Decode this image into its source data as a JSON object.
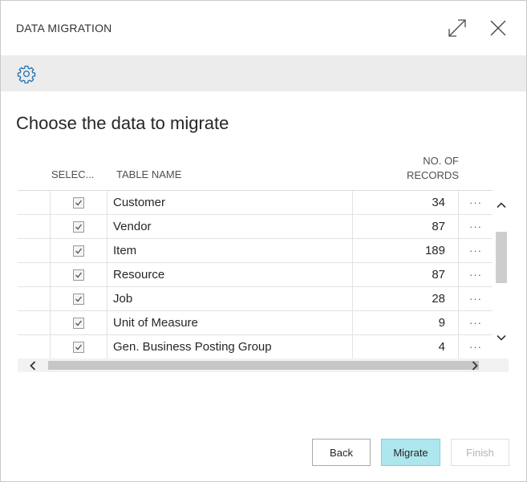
{
  "dialog": {
    "title": "DATA MIGRATION",
    "expand_icon": "expand-icon",
    "close_icon": "close-icon"
  },
  "actionbar": {
    "settings_icon": "gear-icon"
  },
  "page": {
    "heading": "Choose the data to migrate"
  },
  "table": {
    "columns": {
      "select": "SELEC...",
      "table_name": "TABLE NAME",
      "records_line1": "NO. OF",
      "records_line2": "RECORDS"
    },
    "rows": [
      {
        "selected": true,
        "name": "Customer",
        "records": "34",
        "more": "···"
      },
      {
        "selected": true,
        "name": "Vendor",
        "records": "87",
        "more": "···"
      },
      {
        "selected": true,
        "name": "Item",
        "records": "189",
        "more": "···"
      },
      {
        "selected": true,
        "name": "Resource",
        "records": "87",
        "more": "···"
      },
      {
        "selected": true,
        "name": "Job",
        "records": "28",
        "more": "···"
      },
      {
        "selected": true,
        "name": "Unit of Measure",
        "records": "9",
        "more": "···"
      },
      {
        "selected": true,
        "name": "Gen. Business Posting Group",
        "records": "4",
        "more": "···"
      }
    ]
  },
  "buttons": {
    "back": "Back",
    "migrate": "Migrate",
    "finish": "Finish"
  },
  "colors": {
    "accent": "#aee6ee",
    "accent_border": "#7fcfdb",
    "icon_blue": "#1f6fb2",
    "actionbar_bg": "#ececec"
  }
}
